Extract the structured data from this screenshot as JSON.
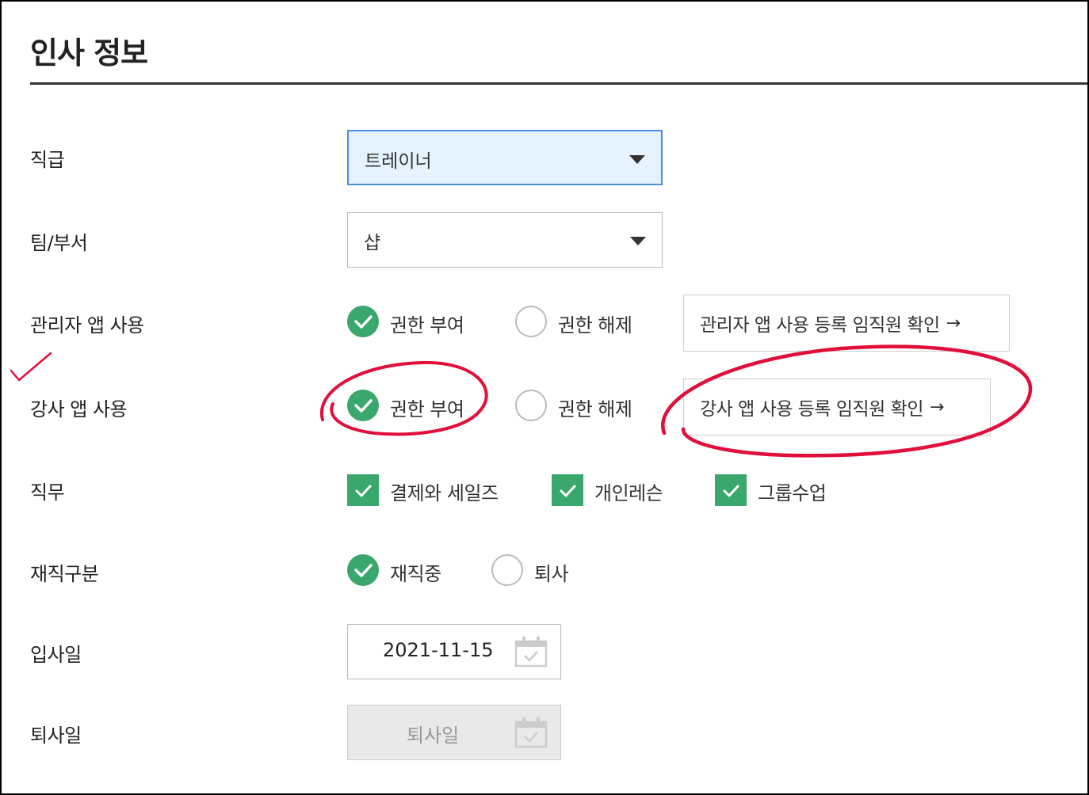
{
  "section": {
    "title": "인사 정보"
  },
  "fields": {
    "position": {
      "label": "직급",
      "value": "트레이너"
    },
    "team": {
      "label": "팀/부서",
      "value": "샵"
    },
    "admin_app": {
      "label": "관리자 앱 사용",
      "grant": "권한 부여",
      "revoke": "권한 해제",
      "link": "관리자 앱 사용 등록 임직원 확인",
      "selected": "grant"
    },
    "instructor_app": {
      "label": "강사 앱 사용",
      "grant": "권한 부여",
      "revoke": "권한 해제",
      "link": "강사 앱 사용 등록 임직원 확인",
      "selected": "grant"
    },
    "duty": {
      "label": "직무",
      "options": [
        "결제와 세일즈",
        "개인레슨",
        "그룹수업"
      ],
      "checked": [
        true,
        true,
        true
      ]
    },
    "employment": {
      "label": "재직구분",
      "employed": "재직중",
      "resigned": "퇴사",
      "selected": "employed"
    },
    "hire_date": {
      "label": "입사일",
      "value": "2021-11-15"
    },
    "leave_date": {
      "label": "퇴사일",
      "placeholder": "퇴사일"
    }
  },
  "link_arrow": "→",
  "colors": {
    "accent_green": "#3aa76d",
    "focus_blue": "#4a90e2",
    "annotation_red": "#e0103a"
  }
}
